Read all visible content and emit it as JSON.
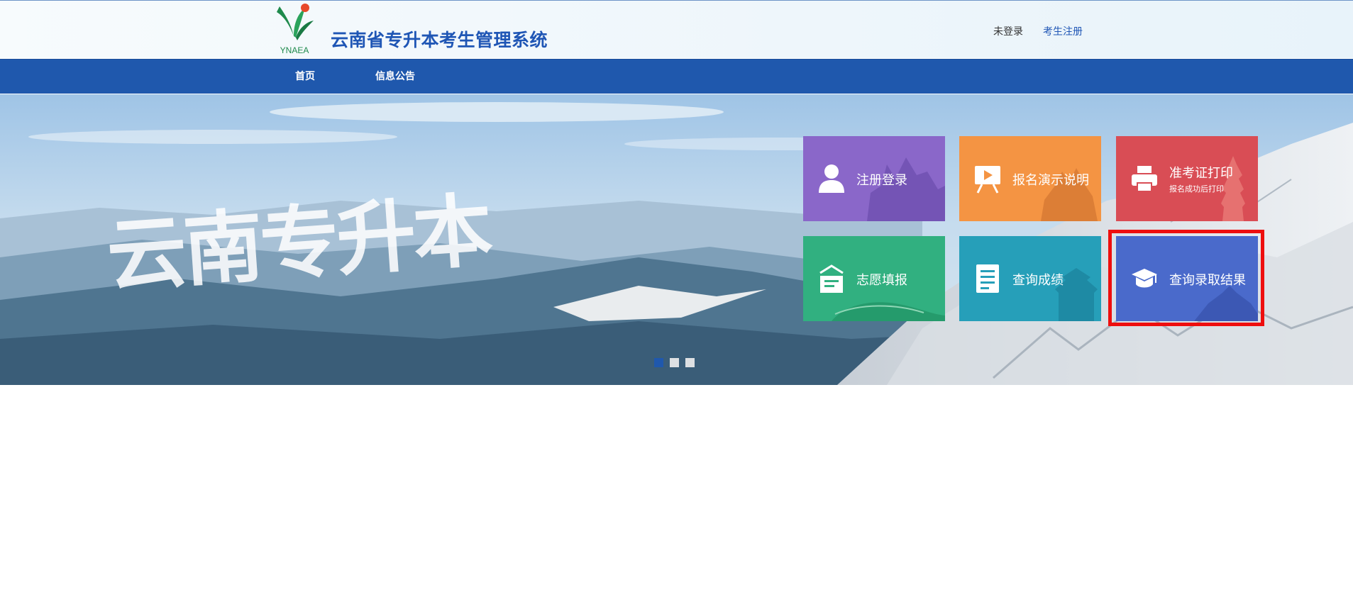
{
  "header": {
    "logo_text": "YNAEA",
    "title": "云南省专升本考生管理系统",
    "login_status": "未登录",
    "register_link": "考生注册"
  },
  "nav": {
    "items": [
      {
        "label": "首页"
      },
      {
        "label": "信息公告"
      }
    ]
  },
  "banner": {
    "script_text": "云南专升本",
    "slides": 3,
    "active_slide": 1
  },
  "tiles": [
    {
      "label": "注册登录",
      "icon": "user-icon",
      "color": "#8a67c9"
    },
    {
      "label": "报名演示说明",
      "icon": "presentation-icon",
      "color": "#f49443"
    },
    {
      "label": "准考证打印",
      "sub": "报名成功后打印",
      "icon": "printer-icon",
      "color": "#d94d55"
    },
    {
      "label": "志愿填报",
      "icon": "form-icon",
      "color": "#31b080"
    },
    {
      "label": "查询成绩",
      "icon": "document-icon",
      "color": "#269fb9"
    },
    {
      "label": "查询录取结果",
      "icon": "graduation-cap-icon",
      "color": "#4a6acb",
      "highlighted": true
    }
  ],
  "colors": {
    "nav_bg": "#1f58ad",
    "title": "#1f56b5",
    "highlight": "#ee0e0e"
  }
}
